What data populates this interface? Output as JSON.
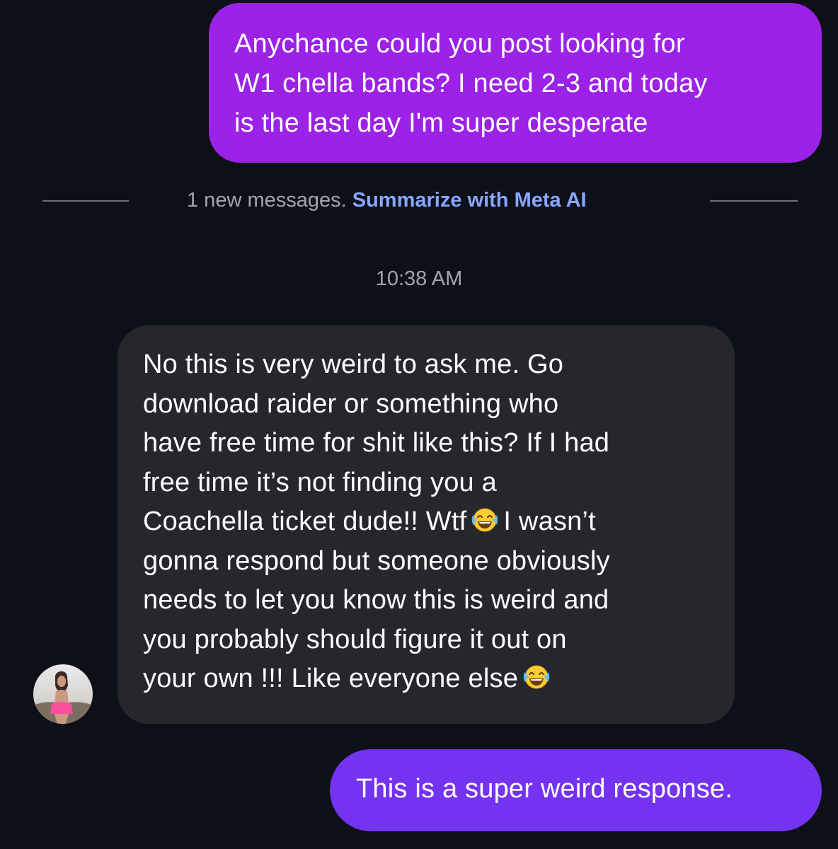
{
  "thread": {
    "outgoing_1": {
      "lines": [
        "Anychance could you post looking for",
        "W1 chella bands? I need 2-3 and today",
        "is the last day I'm super desperate"
      ],
      "bubble_color": "#9b22e6"
    },
    "divider": {
      "text": "1 new messages.",
      "link": "Summarize with Meta AI"
    },
    "timestamp": "10:38 AM",
    "incoming": {
      "line_1": "No this is very weird to ask me. Go",
      "line_2": "download raider or something who",
      "line_3": "have free time for shit like this? If I had",
      "line_4": "free time it’s not finding you a",
      "line_5a": "Coachella ticket dude!! Wtf",
      "line_5b": "I wasn’t",
      "line_6": "gonna respond but someone obviously",
      "line_7": "needs to let you know this is weird and",
      "line_8": "you probably should figure it out on",
      "line_9": "your own !!! Like everyone else",
      "emoji": "face-with-tears-of-joy-icon",
      "bubble_color": "#25272c"
    },
    "outgoing_2": {
      "text": "This is a super weird response.",
      "bubble_color": "#7433f1"
    }
  },
  "colors": {
    "background": "#0d1017",
    "link": "#8aa7ff",
    "meta_text": "#a3a6ae"
  }
}
